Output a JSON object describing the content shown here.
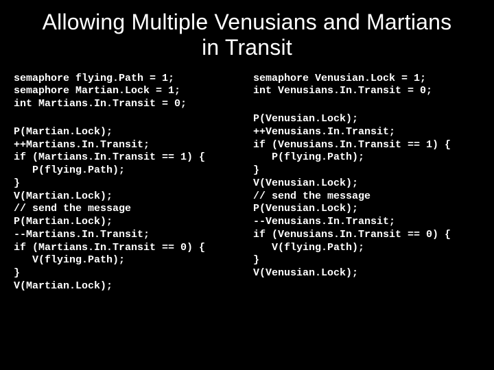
{
  "title": "Allowing Multiple Venusians and Martians in Transit",
  "left": {
    "decl": "semaphore flying.Path = 1;\nsemaphore Martian.Lock = 1;\nint Martians.In.Transit = 0;",
    "body": "P(Martian.Lock);\n++Martians.In.Transit;\nif (Martians.In.Transit == 1) {\n   P(flying.Path);\n}\nV(Martian.Lock);\n// send the message\nP(Martian.Lock);\n--Martians.In.Transit;\nif (Martians.In.Transit == 0) {\n   V(flying.Path);\n}\nV(Martian.Lock);"
  },
  "right": {
    "decl": "semaphore Venusian.Lock = 1;\nint Venusians.In.Transit = 0;",
    "body": "P(Venusian.Lock);\n++Venusians.In.Transit;\nif (Venusians.In.Transit == 1) {\n   P(flying.Path);\n}\nV(Venusian.Lock);\n// send the message\nP(Venusian.Lock);\n--Venusians.In.Transit;\nif (Venusians.In.Transit == 0) {\n   V(flying.Path);\n}\nV(Venusian.Lock);"
  }
}
